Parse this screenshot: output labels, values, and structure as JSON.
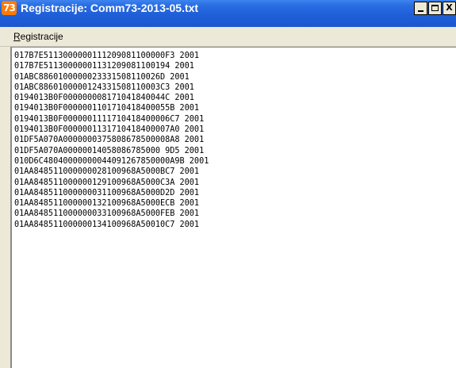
{
  "window": {
    "icon_text": "73",
    "title": "Registracije: Comm73-2013-05.txt",
    "controls": {
      "minimize": "minimize",
      "maximize": "maximize",
      "close": "X"
    }
  },
  "menu": {
    "items": [
      {
        "label": "Registracije",
        "underline_char": "R"
      }
    ]
  },
  "content": {
    "lines": [
      "017B7E5113000000111209081100000F3 2001",
      "017B7E51130000001131209081100194 2001",
      "01ABC8860100000023331508110026D 2001",
      "01ABC8860100000124331508110003C3 2001",
      "0194013B0F000000008171041840044C 2001",
      "0194013B0F0000001101710418400055B 2001",
      "0194013B0F0000001111710418400006C7 2001",
      "0194013B0F0000001131710418400007A0 2001",
      "01DF5A070A0000000375808678500008A8 2001",
      "01DF5A070A00000014058086785000 9D5 2001",
      "010D6C48040000000044091267850000A9B 2001",
      "01AA848511000000028100968A5000BC7 2001",
      "01AA848511000000129100968A5000C3A 2001",
      "01AA848511000000031100968A5000D2D 2001",
      "01AA848511000000132100968A5000ECB 2001",
      "01AA848511000000033100968A5000FEB 2001",
      "01AA848511000000134100968A50010C7 2001"
    ]
  }
}
